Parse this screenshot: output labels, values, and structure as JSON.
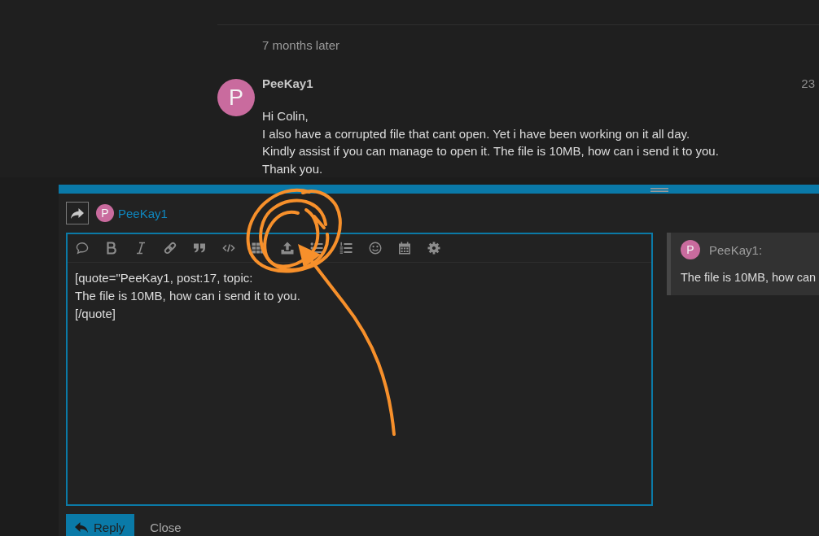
{
  "topic": {
    "time_gap": "7 months later"
  },
  "post": {
    "avatar_letter": "P",
    "author": "PeeKay1",
    "time": "23",
    "body_lines": [
      "Hi Colin,",
      "I also have a corrupted file that cant open. Yet i have been working on it all day.",
      "Kindly assist if you can manage to open it. The file is 10MB, how can i send it to you.",
      "Thank you."
    ]
  },
  "composer": {
    "avatar_letter": "P",
    "reply_to": "PeeKay1",
    "editor_lines": [
      "[quote=\"PeeKay1, post:17, topic:",
      "The file is 10MB, how can i send it to you.",
      "[/quote]"
    ],
    "preview": {
      "avatar_letter": "P",
      "author": "PeeKay1:",
      "quote_text": "The file is 10MB, how can"
    },
    "buttons": [
      {
        "label": "Reply",
        "kind": "primary"
      },
      {
        "label": "Close",
        "kind": "plain"
      }
    ]
  }
}
